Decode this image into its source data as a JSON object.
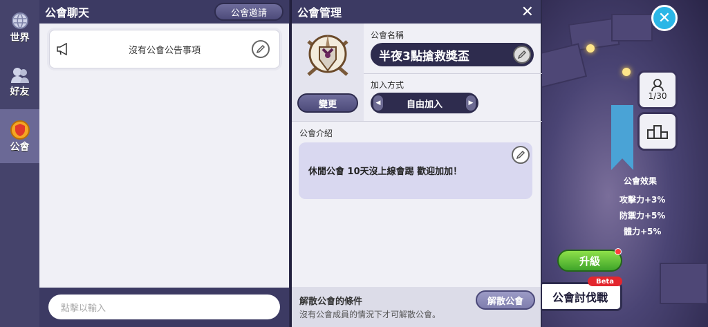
{
  "rail": {
    "items": [
      {
        "label": "世界"
      },
      {
        "label": "好友"
      },
      {
        "label": "公會"
      }
    ]
  },
  "chat": {
    "title": "公會聊天",
    "invite_label": "公會邀請",
    "notice_text": "沒有公會公告事項",
    "input_placeholder": "點擊以輸入"
  },
  "guild": {
    "title": "公會管理",
    "change_label": "變更",
    "name_label": "公會名稱",
    "name_value": "半夜3點搶救獎盃",
    "join_label": "加入方式",
    "join_value": "自由加入",
    "intro_label": "公會介紹",
    "intro_text": "休閒公會 10天沒上線會踢 歡迎加加！",
    "disband_title": "解散公會的條件",
    "disband_sub": "沒有公會成員的情況下才可解散公會。",
    "disband_button": "解散公會"
  },
  "game": {
    "member_count": "1/30",
    "effect_title": "公會效果",
    "effects": [
      "攻擊力+3%",
      "防禦力+5%",
      "體力+5%"
    ],
    "upgrade_label": "升級",
    "raid_label": "公會討伐戰",
    "beta_label": "Beta"
  },
  "colors": {
    "header": "#3c3a63",
    "accent_cyan": "#2bb6e6",
    "upgrade_green": "#3fa52a",
    "badge_red": "#e3262e"
  }
}
